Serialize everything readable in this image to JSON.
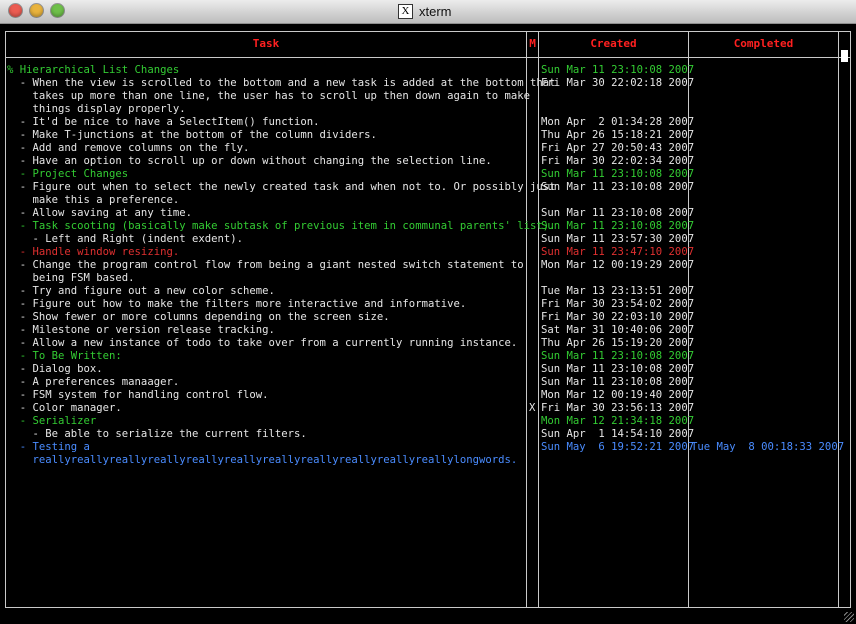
{
  "window": {
    "title": "xterm"
  },
  "columns": {
    "task": "Task",
    "mark": "M",
    "created": "Created",
    "completed": "Completed"
  },
  "rows": [
    {
      "task": "% Hierarchical List Changes",
      "mark": "",
      "created": "Sun Mar 11 23:10:08 2007",
      "completed": "",
      "color": "green",
      "task_color": "green",
      "mark_prefix": "%"
    },
    {
      "task": "  - When the view is scrolled to the bottom and a new task is added at the bottom that",
      "mark": "",
      "created": "Fri Mar 30 22:02:18 2007",
      "completed": "",
      "color": "white"
    },
    {
      "task": "    takes up more than one line, the user has to scroll up then down again to make",
      "mark": "",
      "created": "",
      "completed": "",
      "color": "white"
    },
    {
      "task": "    things display properly.",
      "mark": "",
      "created": "",
      "completed": "",
      "color": "white"
    },
    {
      "task": "  - It'd be nice to have a SelectItem() function.",
      "mark": "",
      "created": "Mon Apr  2 01:34:28 2007",
      "completed": "",
      "color": "white"
    },
    {
      "task": "  - Make T-junctions at the bottom of the column dividers.",
      "mark": "",
      "created": "Thu Apr 26 15:18:21 2007",
      "completed": "",
      "color": "white"
    },
    {
      "task": "  - Add and remove columns on the fly.",
      "mark": "",
      "created": "Fri Apr 27 20:50:43 2007",
      "completed": "",
      "color": "white"
    },
    {
      "task": "  - Have an option to scroll up or down without changing the selection line.",
      "mark": "",
      "created": "Fri Mar 30 22:02:34 2007",
      "completed": "",
      "color": "white"
    },
    {
      "task": "  - Project Changes",
      "mark": "",
      "created": "Sun Mar 11 23:10:08 2007",
      "completed": "",
      "color": "green"
    },
    {
      "task": "  - Figure out when to select the newly created task and when not to. Or possibly just",
      "mark": "",
      "created": "Sun Mar 11 23:10:08 2007",
      "completed": "",
      "color": "white"
    },
    {
      "task": "    make this a preference.",
      "mark": "",
      "created": "",
      "completed": "",
      "color": "white"
    },
    {
      "task": "  - Allow saving at any time.",
      "mark": "",
      "created": "Sun Mar 11 23:10:08 2007",
      "completed": "",
      "color": "white"
    },
    {
      "task": "  - Task scooting (basically make subtask of previous item in communal parents' list).",
      "mark": "",
      "created": "Sun Mar 11 23:10:08 2007",
      "completed": "",
      "color": "green"
    },
    {
      "task": "    - Left and Right (indent exdent).",
      "mark": "",
      "created": "Sun Mar 11 23:57:30 2007",
      "completed": "",
      "color": "white"
    },
    {
      "task": "  - Handle window resizing.",
      "mark": "",
      "created": "Sun Mar 11 23:47:10 2007",
      "completed": "",
      "color": "red"
    },
    {
      "task": "  - Change the program control flow from being a giant nested switch statement to",
      "mark": "",
      "created": "Mon Mar 12 00:19:29 2007",
      "completed": "",
      "color": "white"
    },
    {
      "task": "    being FSM based.",
      "mark": "",
      "created": "",
      "completed": "",
      "color": "white"
    },
    {
      "task": "  - Try and figure out a new color scheme.",
      "mark": "",
      "created": "Tue Mar 13 23:13:51 2007",
      "completed": "",
      "color": "white"
    },
    {
      "task": "  - Figure out how to make the filters more interactive and informative.",
      "mark": "",
      "created": "Fri Mar 30 23:54:02 2007",
      "completed": "",
      "color": "white"
    },
    {
      "task": "  - Show fewer or more columns depending on the screen size.",
      "mark": "",
      "created": "Fri Mar 30 22:03:10 2007",
      "completed": "",
      "color": "white"
    },
    {
      "task": "  - Milestone or version release tracking.",
      "mark": "",
      "created": "Sat Mar 31 10:40:06 2007",
      "completed": "",
      "color": "white"
    },
    {
      "task": "  - Allow a new instance of todo to take over from a currently running instance.",
      "mark": "",
      "created": "Thu Apr 26 15:19:20 2007",
      "completed": "",
      "color": "white"
    },
    {
      "task": "  - To Be Written:",
      "mark": "",
      "created": "Sun Mar 11 23:10:08 2007",
      "completed": "",
      "color": "green"
    },
    {
      "task": "  - Dialog box.",
      "mark": "",
      "created": "Sun Mar 11 23:10:08 2007",
      "completed": "",
      "color": "white"
    },
    {
      "task": "  - A preferences manaager.",
      "mark": "",
      "created": "Sun Mar 11 23:10:08 2007",
      "completed": "",
      "color": "white"
    },
    {
      "task": "  - FSM system for handling control flow.",
      "mark": "",
      "created": "Mon Mar 12 00:19:40 2007",
      "completed": "",
      "color": "white"
    },
    {
      "task": "  - Color manager.",
      "mark": "X",
      "created": "Fri Mar 30 23:56:13 2007",
      "completed": "",
      "color": "white"
    },
    {
      "task": "  - Serializer",
      "mark": "",
      "created": "Mon Mar 12 21:34:18 2007",
      "completed": "",
      "color": "green"
    },
    {
      "task": "    - Be able to serialize the current filters.",
      "mark": "",
      "created": "Sun Apr  1 14:54:10 2007",
      "completed": "",
      "color": "white"
    },
    {
      "task": "  - Testing a",
      "mark": "",
      "created": "Sun May  6 19:52:21 2007",
      "completed": "Tue May  8 00:18:33 2007",
      "color": "blue"
    },
    {
      "task": "    reallyreallyreallyreallyreallyreallyreallyreallyreallyreallyreallylongwords.",
      "mark": "",
      "created": "",
      "completed": "",
      "color": "blue"
    }
  ]
}
